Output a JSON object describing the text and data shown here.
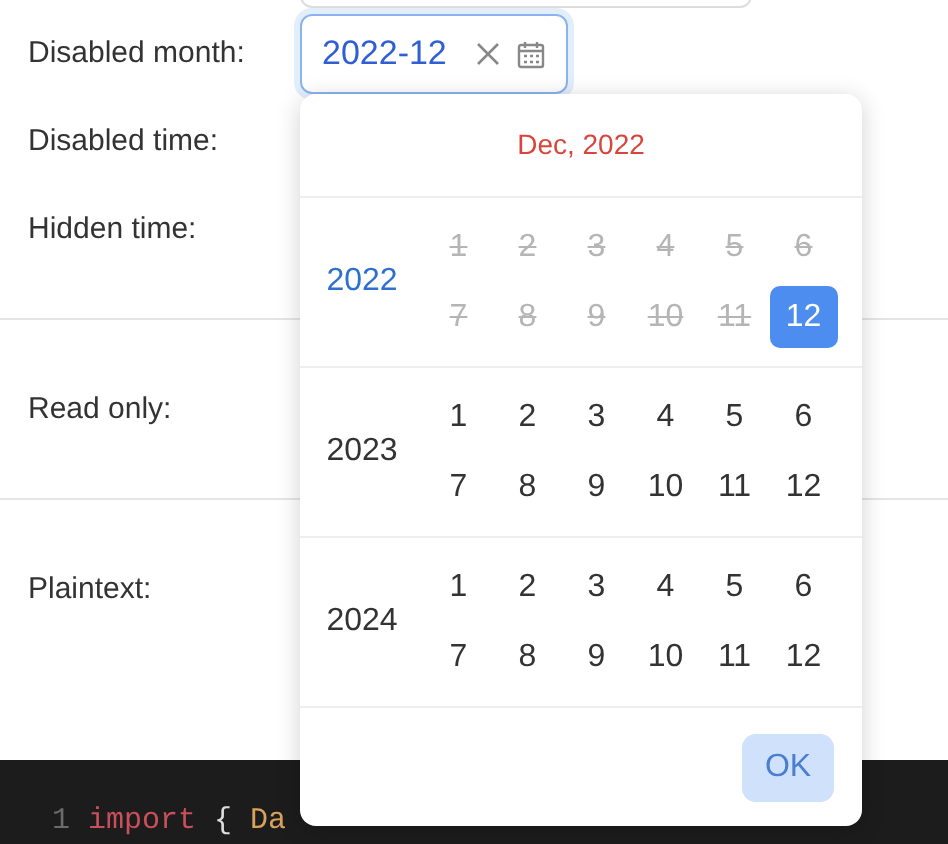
{
  "form": [
    {
      "kind": "field_row",
      "label": "Disabled month:",
      "field": {
        "value": "2022-12",
        "focused": true
      }
    },
    {
      "kind": "label",
      "label": "Disabled time:"
    },
    {
      "kind": "label",
      "label": "Hidden time:"
    },
    {
      "kind": "divider"
    },
    {
      "kind": "label",
      "label": "Read only:"
    },
    {
      "kind": "divider"
    },
    {
      "kind": "label",
      "label": "Plaintext:"
    }
  ],
  "popup": {
    "header": "Dec, 2022",
    "years": [
      {
        "year": "2022",
        "current": true,
        "months": [
          {
            "label": "1",
            "disabled": true,
            "selected": false
          },
          {
            "label": "2",
            "disabled": true,
            "selected": false
          },
          {
            "label": "3",
            "disabled": true,
            "selected": false
          },
          {
            "label": "4",
            "disabled": true,
            "selected": false
          },
          {
            "label": "5",
            "disabled": true,
            "selected": false
          },
          {
            "label": "6",
            "disabled": true,
            "selected": false
          },
          {
            "label": "7",
            "disabled": true,
            "selected": false
          },
          {
            "label": "8",
            "disabled": true,
            "selected": false
          },
          {
            "label": "9",
            "disabled": true,
            "selected": false
          },
          {
            "label": "10",
            "disabled": true,
            "selected": false
          },
          {
            "label": "11",
            "disabled": true,
            "selected": false
          },
          {
            "label": "12",
            "disabled": false,
            "selected": true
          }
        ]
      },
      {
        "year": "2023",
        "current": false,
        "months": [
          {
            "label": "1",
            "disabled": false,
            "selected": false
          },
          {
            "label": "2",
            "disabled": false,
            "selected": false
          },
          {
            "label": "3",
            "disabled": false,
            "selected": false
          },
          {
            "label": "4",
            "disabled": false,
            "selected": false
          },
          {
            "label": "5",
            "disabled": false,
            "selected": false
          },
          {
            "label": "6",
            "disabled": false,
            "selected": false
          },
          {
            "label": "7",
            "disabled": false,
            "selected": false
          },
          {
            "label": "8",
            "disabled": false,
            "selected": false
          },
          {
            "label": "9",
            "disabled": false,
            "selected": false
          },
          {
            "label": "10",
            "disabled": false,
            "selected": false
          },
          {
            "label": "11",
            "disabled": false,
            "selected": false
          },
          {
            "label": "12",
            "disabled": false,
            "selected": false
          }
        ]
      },
      {
        "year": "2024",
        "current": false,
        "months": [
          {
            "label": "1",
            "disabled": false,
            "selected": false
          },
          {
            "label": "2",
            "disabled": false,
            "selected": false
          },
          {
            "label": "3",
            "disabled": false,
            "selected": false
          },
          {
            "label": "4",
            "disabled": false,
            "selected": false
          },
          {
            "label": "5",
            "disabled": false,
            "selected": false
          },
          {
            "label": "6",
            "disabled": false,
            "selected": false
          },
          {
            "label": "7",
            "disabled": false,
            "selected": false
          },
          {
            "label": "8",
            "disabled": false,
            "selected": false
          },
          {
            "label": "9",
            "disabled": false,
            "selected": false
          },
          {
            "label": "10",
            "disabled": false,
            "selected": false
          },
          {
            "label": "11",
            "disabled": false,
            "selected": false
          },
          {
            "label": "12",
            "disabled": false,
            "selected": false
          }
        ]
      }
    ],
    "ok_button": {
      "label": "OK",
      "disabled": true
    }
  },
  "code": {
    "line_number": "1",
    "tokens": [
      {
        "text": "import",
        "kind": "keyword"
      },
      {
        "text": "{",
        "kind": "plain"
      },
      {
        "text": "Da",
        "kind": "ident"
      }
    ]
  }
}
